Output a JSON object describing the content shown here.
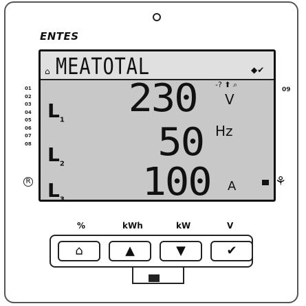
{
  "brand": "ENTES",
  "display": {
    "title": "MEATOTAL",
    "title_icon_left": "⌂",
    "title_icons_right": "◆✔",
    "rows": [
      {
        "phase": "L",
        "phase_sub": "1",
        "value": "230",
        "unit": "V"
      },
      {
        "phase": "L",
        "phase_sub": "2",
        "value": "50",
        "unit": "Hz"
      },
      {
        "phase": "L",
        "phase_sub": "3",
        "value": "100",
        "unit": "A"
      }
    ],
    "indicators": "-? ⬆ ⌕"
  },
  "leds": [
    "01",
    "02",
    "03",
    "04",
    "05",
    "06",
    "07",
    "08"
  ],
  "led_badge": "R",
  "side_mark": "09",
  "buttons": [
    {
      "label": "%",
      "icon": "⌂",
      "icon_name": "home-icon"
    },
    {
      "label": "kWh",
      "icon": "▲",
      "icon_name": "up-icon"
    },
    {
      "label": "kW",
      "icon": "▼",
      "icon_name": "down-icon"
    },
    {
      "label": "V",
      "icon": "✔",
      "icon_name": "check-icon"
    }
  ]
}
